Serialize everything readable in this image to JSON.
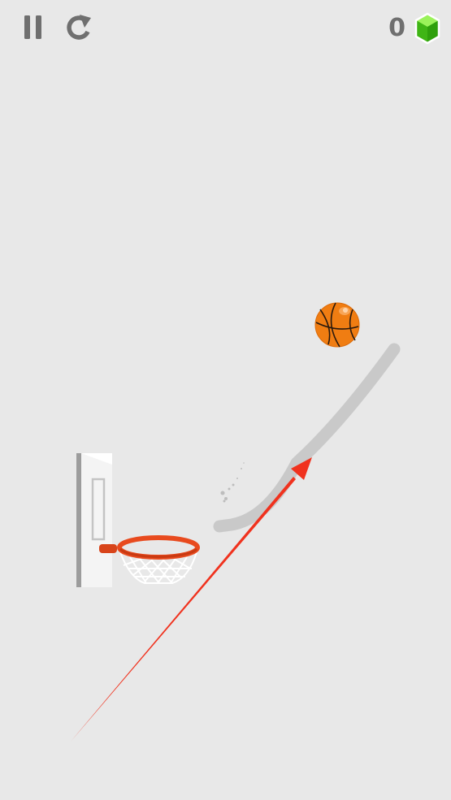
{
  "hud": {
    "pause_icon": "pause-icon",
    "restart_icon": "restart-icon",
    "gem_count": "0",
    "gem_icon": "green-gem-icon"
  },
  "colors": {
    "background": "#e8e8e8",
    "hud_gray": "#6f6f6f",
    "gem_green": "#4cd21c",
    "ball_orange": "#f07d12",
    "rim_red": "#e84a1e",
    "drawn_line": "#c9c9c9",
    "arrow_red": "#f0321e"
  }
}
